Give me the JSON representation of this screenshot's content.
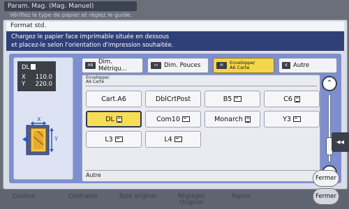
{
  "background": {
    "title": "Param. Mag. (Mag. Manuel)",
    "subtitle": "Vérifiez le type de papier et réglez le guide.",
    "bottom_items": [
      "Couleur",
      "Contraste",
      "Type original",
      "Réglages Original",
      "Papier"
    ],
    "close_label": "Fermer"
  },
  "dialog": {
    "title": "Format std.",
    "instruction_line1": "Chargez le papier face imprimable située en dessous",
    "instruction_line2": "et placez-le selon l'orientation d'impression souhaitée.",
    "close_label": "Fermer"
  },
  "preview": {
    "size_name": "DL",
    "x_label": "X",
    "x_value": "110.0",
    "y_label": "Y",
    "y_value": "220.0",
    "diagram_x": "X",
    "diagram_y": "Y"
  },
  "tabs": [
    {
      "icon_text": "AB",
      "label": "Dim. Métriqu...",
      "active": false
    },
    {
      "icon_text": "in",
      "label": "Dim. Pouces",
      "active": false
    },
    {
      "icon_text": "",
      "label_line1": "Enveloppe/",
      "label_line2": "A6 Carte",
      "active": true
    },
    {
      "icon_text": "K",
      "label": "Autre",
      "active": false
    }
  ],
  "grid": {
    "header_line1": "Enveloppe/",
    "header_line2": "A6 Carte",
    "footer": "Autre",
    "items": [
      {
        "label": "Cart.A6",
        "icon": "none",
        "selected": false
      },
      {
        "label": "DblCrtPost",
        "icon": "none",
        "selected": false
      },
      {
        "label": "B5",
        "icon": "landscape",
        "selected": false
      },
      {
        "label": "C6",
        "icon": "portrait",
        "selected": false
      },
      {
        "label": "DL",
        "icon": "portrait",
        "selected": true
      },
      {
        "label": "Com10",
        "icon": "landscape",
        "selected": false
      },
      {
        "label": "Monarch",
        "icon": "portrait",
        "selected": false
      },
      {
        "label": "Y3",
        "icon": "landscape",
        "selected": false
      },
      {
        "label": "L3",
        "icon": "landscape",
        "selected": false
      },
      {
        "label": "L4",
        "icon": "landscape",
        "selected": false
      }
    ]
  },
  "colors": {
    "accent": "#f7dc55",
    "instruction_bg": "#2f3f78",
    "panel_bg": "#7d8fd0"
  }
}
